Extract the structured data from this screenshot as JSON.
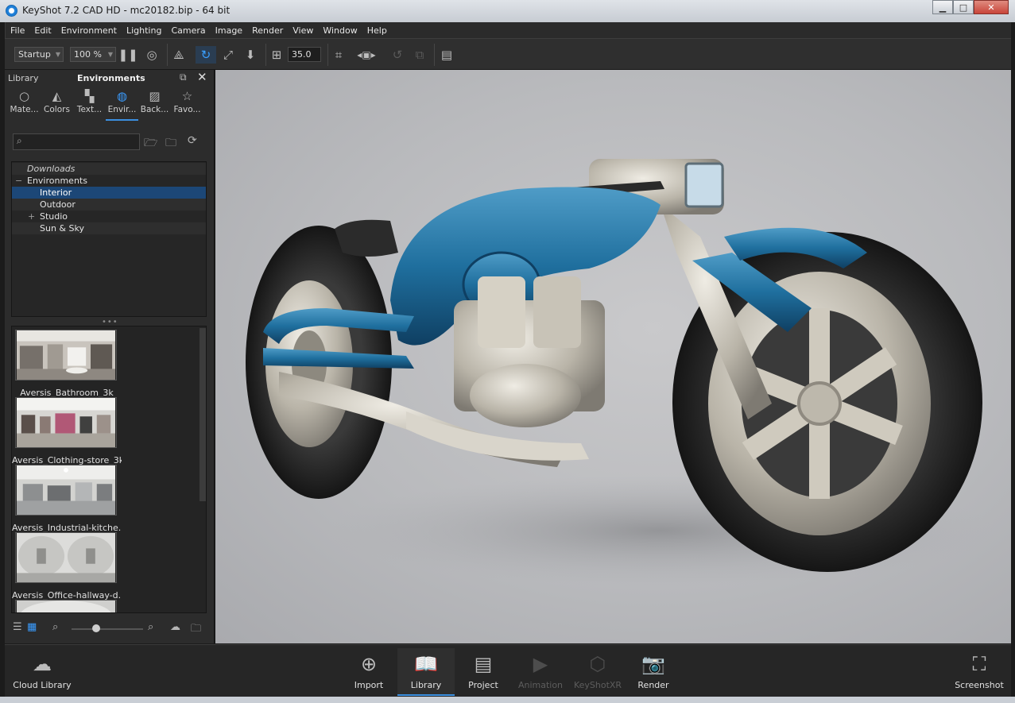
{
  "window": {
    "title": "KeyShot 7.2 CAD HD  -  mc20182.bip  -  64 bit",
    "minimize": "▁",
    "maximize": "□",
    "close": "✕"
  },
  "menu": [
    "File",
    "Edit",
    "Environment",
    "Lighting",
    "Camera",
    "Image",
    "Render",
    "View",
    "Window",
    "Help"
  ],
  "toolbar": {
    "preset": "Startup",
    "zoom": "100 %",
    "focal_length": "35.0"
  },
  "library": {
    "label": "Library",
    "section_title": "Environments",
    "tabs": [
      {
        "label": "Mate...",
        "icon": "materials-icon"
      },
      {
        "label": "Colors",
        "icon": "colors-icon"
      },
      {
        "label": "Text...",
        "icon": "textures-icon"
      },
      {
        "label": "Envir...",
        "icon": "environments-icon"
      },
      {
        "label": "Back...",
        "icon": "backplates-icon"
      },
      {
        "label": "Favo...",
        "icon": "favorites-icon"
      }
    ],
    "search_placeholder": "",
    "tree": [
      {
        "label": "Downloads"
      },
      {
        "label": "Environments"
      },
      {
        "label": "Interior"
      },
      {
        "label": "Outdoor"
      },
      {
        "label": "Studio"
      },
      {
        "label": "Sun & Sky"
      }
    ],
    "thumbnails": [
      {
        "caption": "Aversis_Bathroom_3k"
      },
      {
        "caption": "Aversis_Clothing-store_3k"
      },
      {
        "caption": "Aversis_Industrial-kitche..."
      },
      {
        "caption": "Aversis_Office-hallway-d..."
      }
    ]
  },
  "ribbon": {
    "cloud_library": "Cloud Library",
    "import": "Import",
    "library": "Library",
    "project": "Project",
    "animation": "Animation",
    "keyshotxr": "KeyShotXR",
    "render": "Render",
    "screenshot": "Screenshot"
  }
}
